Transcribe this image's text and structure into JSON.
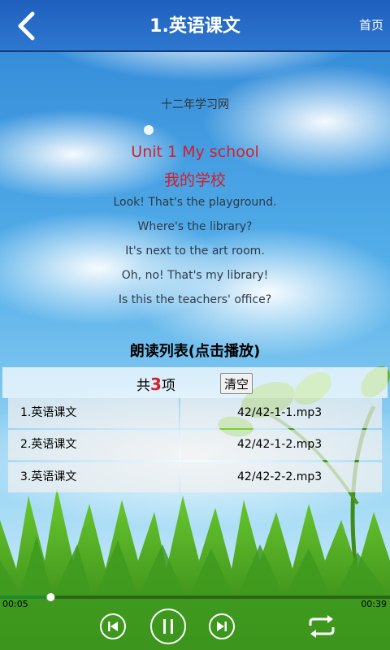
{
  "header": {
    "title": "1.英语课文",
    "home_label": "首页",
    "back_icon": "chevron-left-icon",
    "bar_color": "#2a6cc7"
  },
  "lesson": {
    "site": "十二年学习网",
    "title_en": "Unit 1 My school",
    "title_zh": "我的学校",
    "title_color": "#d21f2b",
    "lines": [
      "Look! That's the playground.",
      "Where's the library?",
      "It's next to the art room.",
      "Oh, no! That's my library!",
      "Is this the teachers' office?"
    ]
  },
  "playlist": {
    "heading": "朗读列表(点击播放)",
    "count_prefix": "共",
    "count": "3",
    "count_suffix": "项",
    "clear_label": "清空",
    "items": [
      {
        "name": "1.英语课文",
        "file": "42/42-1-1.mp3"
      },
      {
        "name": "2.英语课文",
        "file": "42/42-1-2.mp3"
      },
      {
        "name": "3.英语课文",
        "file": "42/42-2-2.mp3"
      }
    ]
  },
  "player": {
    "elapsed": "00:05",
    "duration": "00:39",
    "progress_fraction": 0.13,
    "progress_color": "#1e8b2e",
    "icons": [
      "previous-icon",
      "pause-icon",
      "next-icon",
      "repeat-icon"
    ]
  }
}
